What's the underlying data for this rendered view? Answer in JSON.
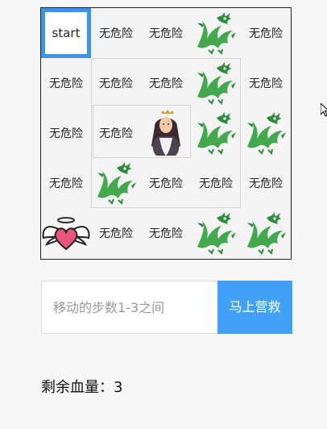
{
  "board": {
    "rows": [
      [
        {
          "type": "start",
          "label": "start"
        },
        {
          "type": "safe",
          "label": "无危险"
        },
        {
          "type": "safe",
          "label": "无危险"
        },
        {
          "type": "dragon",
          "icon": "dragon-icon"
        },
        {
          "type": "safe",
          "label": "无危险"
        }
      ],
      [
        {
          "type": "safe",
          "label": "无危险"
        },
        {
          "type": "safe",
          "label": "无危险"
        },
        {
          "type": "safe",
          "label": "无危险"
        },
        {
          "type": "dragon",
          "icon": "dragon-icon"
        },
        {
          "type": "safe",
          "label": "无危险"
        }
      ],
      [
        {
          "type": "safe",
          "label": "无危险"
        },
        {
          "type": "safe",
          "label": "无危险"
        },
        {
          "type": "princess",
          "icon": "princess-icon"
        },
        {
          "type": "dragon",
          "icon": "dragon-icon"
        },
        {
          "type": "dragon",
          "icon": "dragon-icon"
        }
      ],
      [
        {
          "type": "safe",
          "label": "无危险"
        },
        {
          "type": "dragon",
          "icon": "dragon-icon"
        },
        {
          "type": "safe",
          "label": "无危险"
        },
        {
          "type": "safe",
          "label": "无危险"
        },
        {
          "type": "safe",
          "label": "无危险"
        }
      ],
      [
        {
          "type": "heart",
          "icon": "winged-heart-icon"
        },
        {
          "type": "safe",
          "label": "无危险"
        },
        {
          "type": "safe",
          "label": "无危险"
        },
        {
          "type": "dragon",
          "icon": "dragon-icon"
        },
        {
          "type": "dragon",
          "icon": "dragon-icon"
        }
      ]
    ]
  },
  "controls": {
    "step_placeholder": "移动的步数1-3之间",
    "step_value": "",
    "rescue_label": "马上营救"
  },
  "status": {
    "hp_label": "剩余血量：",
    "hp_value": "3"
  },
  "colors": {
    "accent": "#42a0f7",
    "start_border": "#3b95ee",
    "dragon": "#3aa04a",
    "heart": "#e8547a"
  }
}
